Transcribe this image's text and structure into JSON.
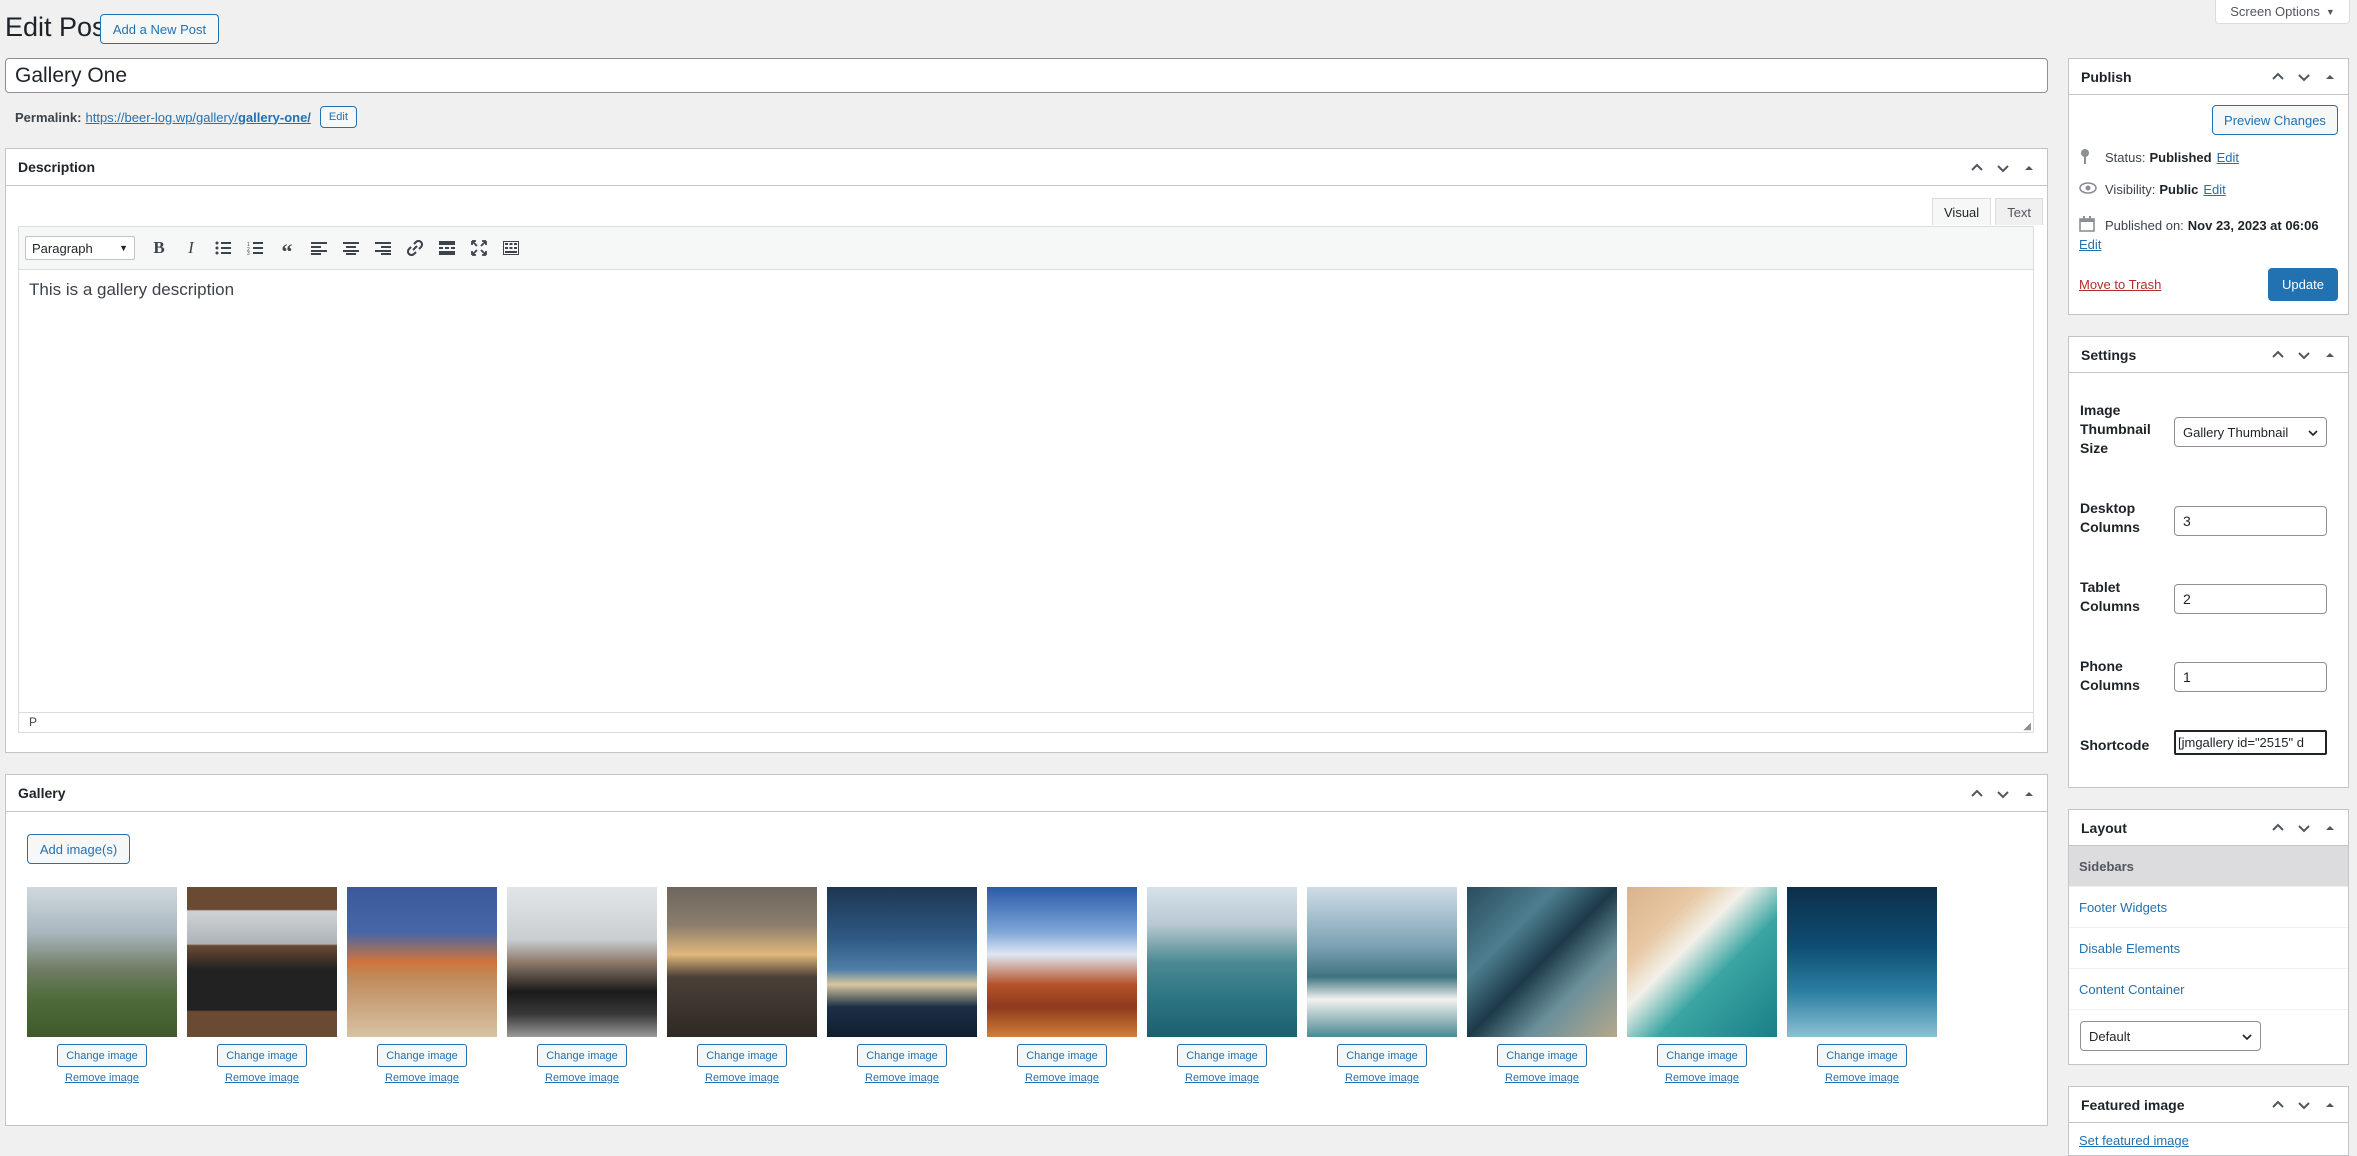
{
  "header": {
    "title": "Edit Post",
    "add_new_label": "Add a New Post",
    "screen_options_label": "Screen Options"
  },
  "post": {
    "title": "Gallery One",
    "permalink_label": "Permalink:",
    "permalink_base": "https://beer-log.wp/gallery/",
    "permalink_slug": "gallery-one/",
    "permalink_edit": "Edit"
  },
  "description_box": {
    "title": "Description",
    "tabs": [
      "Visual",
      "Text"
    ],
    "format_select": "Paragraph",
    "content": "This is a gallery description",
    "path": "P"
  },
  "gallery_box": {
    "title": "Gallery",
    "add_label": "Add image(s)",
    "change_label": "Change image",
    "remove_label": "Remove image",
    "images": [
      {
        "name": "castle-hillside"
      },
      {
        "name": "laptop-desk"
      },
      {
        "name": "orange-flowers"
      },
      {
        "name": "black-car"
      },
      {
        "name": "city-buildings"
      },
      {
        "name": "opera-house-dusk"
      },
      {
        "name": "desert-rock"
      },
      {
        "name": "harbour-boats"
      },
      {
        "name": "harbour-bridge"
      },
      {
        "name": "coastal-road"
      },
      {
        "name": "beach-waves"
      },
      {
        "name": "underwater"
      }
    ]
  },
  "publish": {
    "title": "Publish",
    "preview_label": "Preview Changes",
    "status_label": "Status:",
    "status_value": "Published",
    "visibility_label": "Visibility:",
    "visibility_value": "Public",
    "published_label": "Published on:",
    "published_value": "Nov 23, 2023 at 06:06",
    "edit": "Edit",
    "trash_label": "Move to Trash",
    "update_label": "Update"
  },
  "settings": {
    "title": "Settings",
    "thumb_size_label": "Image Thumbnail Size",
    "thumb_size_value": "Gallery Thumbnail",
    "desktop_label": "Desktop Columns",
    "desktop_value": "3",
    "tablet_label": "Tablet Columns",
    "tablet_value": "2",
    "phone_label": "Phone Columns",
    "phone_value": "1",
    "shortcode_label": "Shortcode",
    "shortcode_value": "[jmgallery id=\"2515\" d"
  },
  "layout": {
    "title": "Layout",
    "items": [
      "Sidebars",
      "Footer Widgets",
      "Disable Elements",
      "Content Container"
    ],
    "select_value": "Default"
  },
  "featured": {
    "title": "Featured image",
    "link": "Set featured image"
  },
  "colors": {
    "accent": "#2271b1",
    "background": "#f0f0f1",
    "trash": "#b32d2e"
  }
}
